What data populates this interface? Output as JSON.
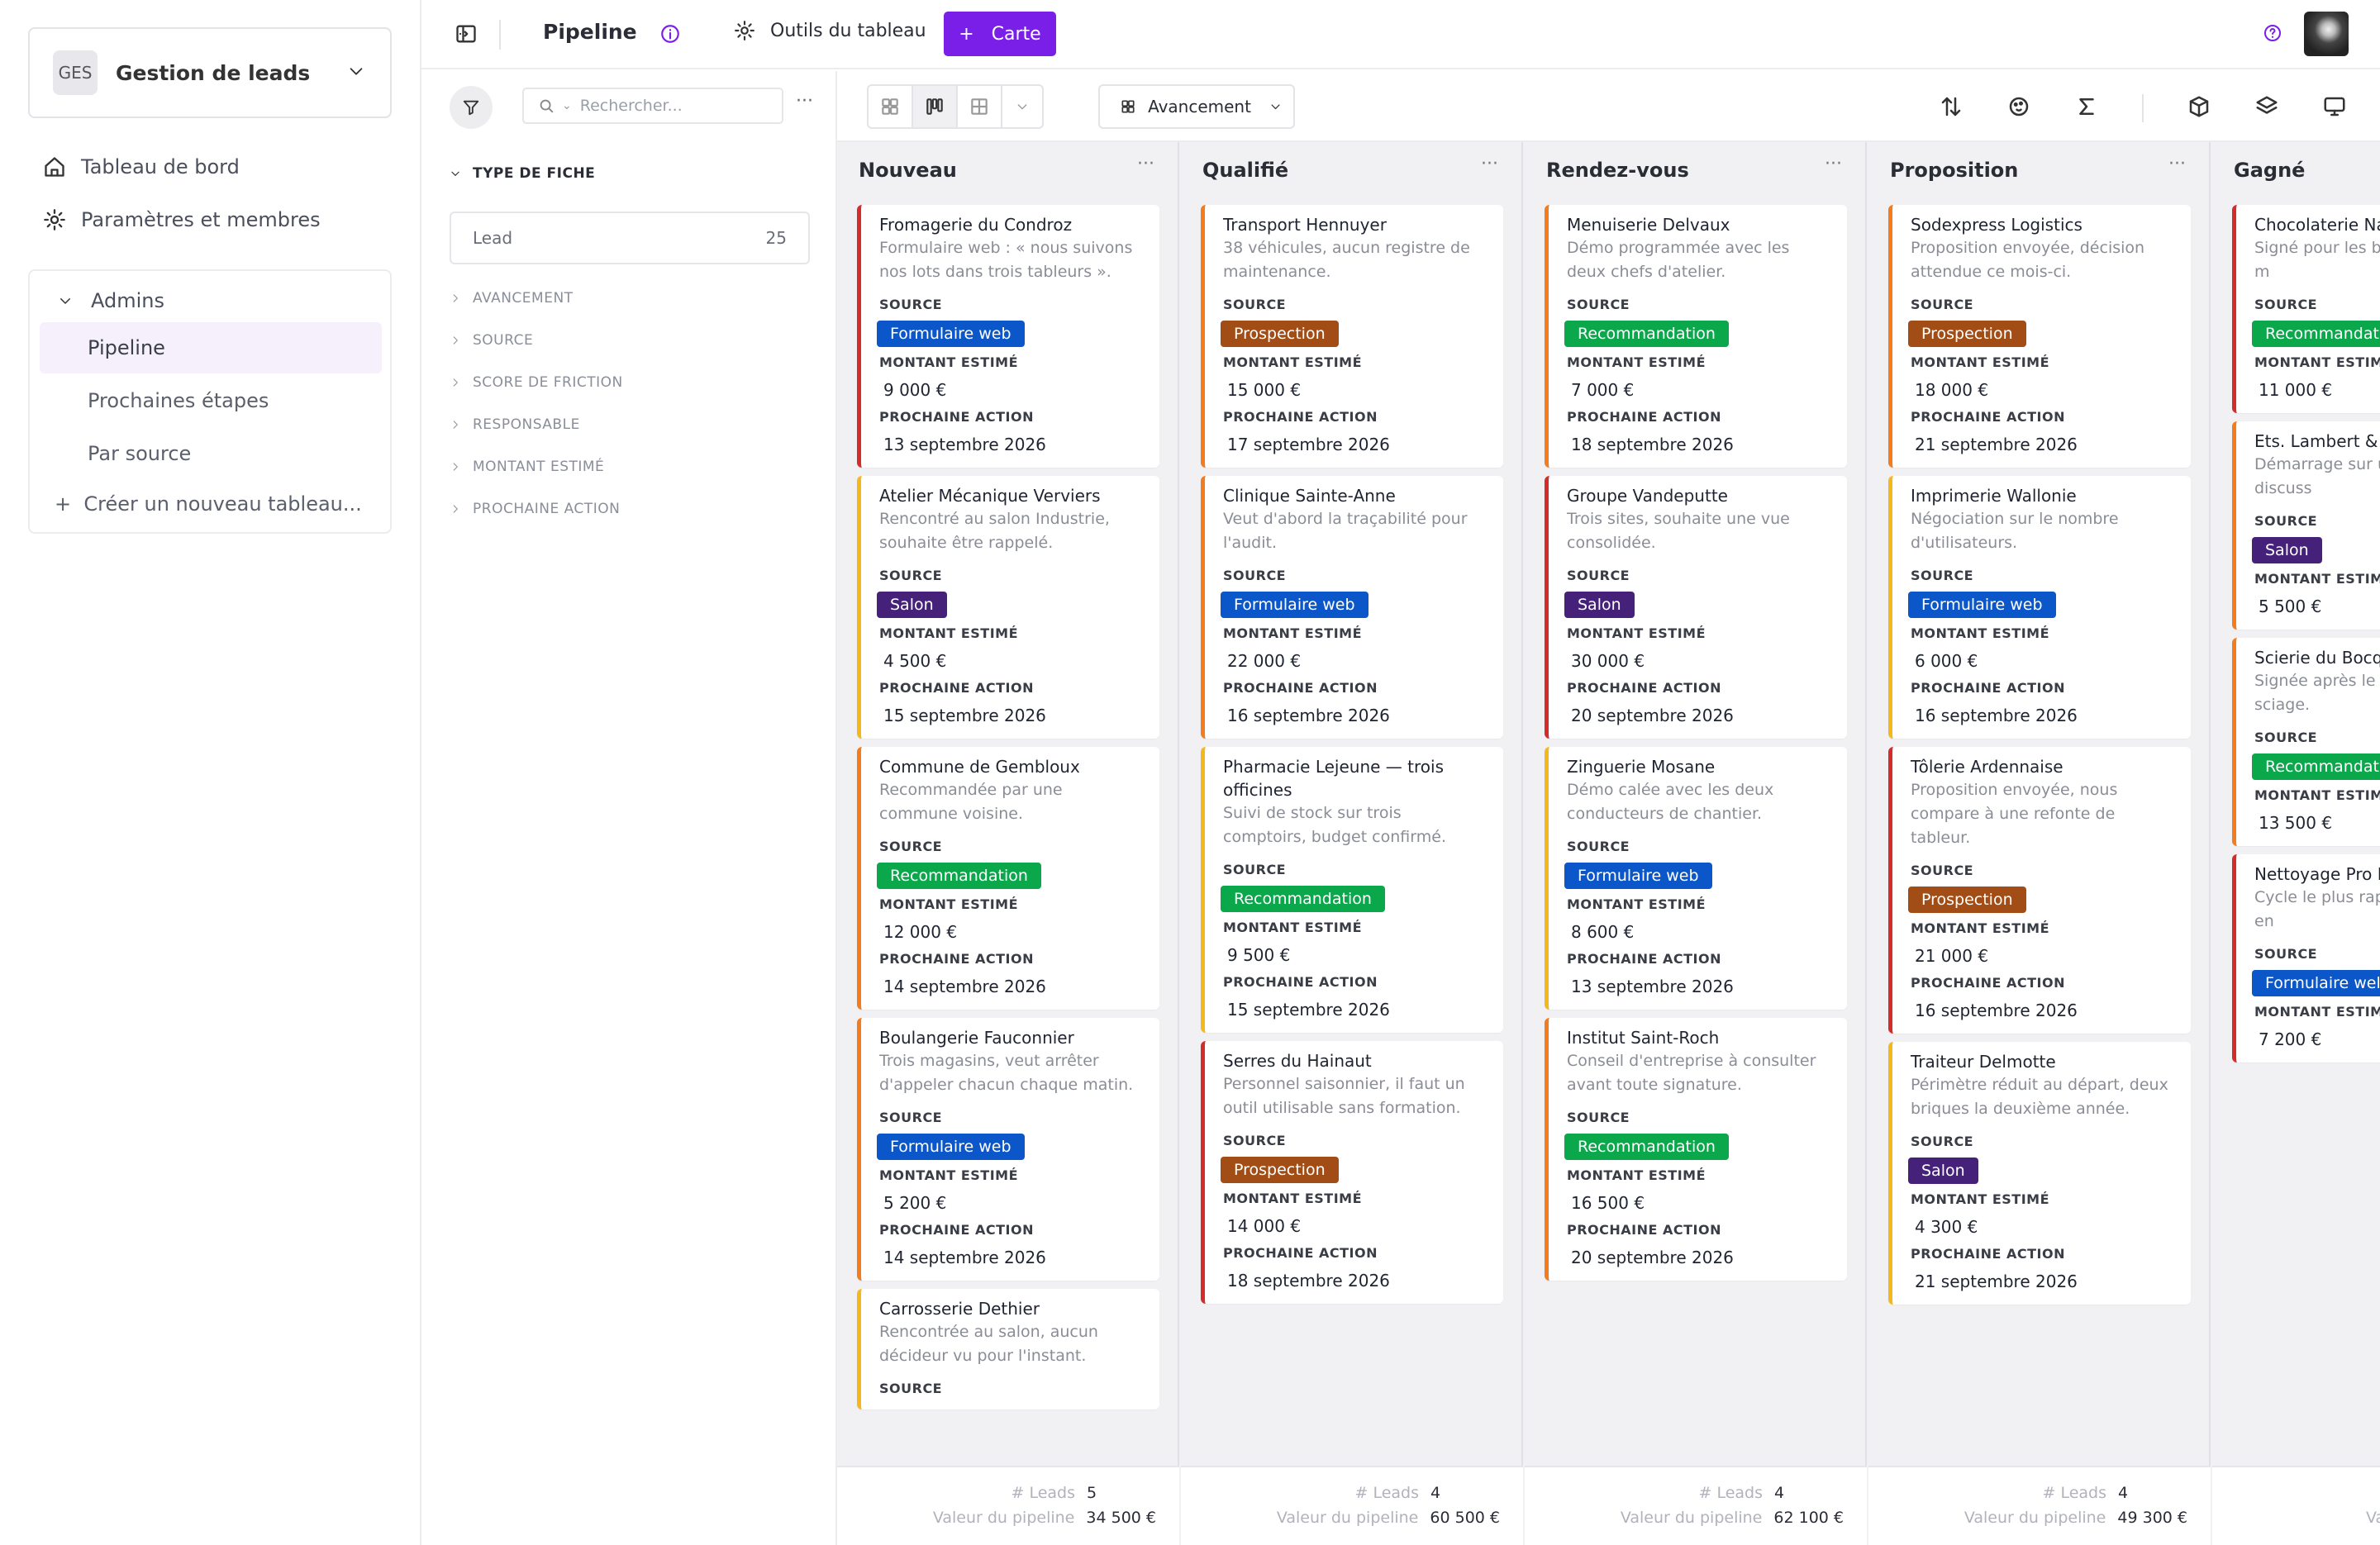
{
  "workspace": {
    "badge": "GES",
    "name": "Gestion de leads"
  },
  "nav": {
    "dashboard": "Tableau de bord",
    "settings": "Paramètres et membres"
  },
  "boards": {
    "group": "Admins",
    "items": [
      "Pipeline",
      "Prochaines étapes",
      "Par source"
    ],
    "create": "Créer un nouveau tableau..."
  },
  "topbar": {
    "title": "Pipeline",
    "tools": "Outils du tableau",
    "add_label": "Carte"
  },
  "filters": {
    "search_placeholder": "Rechercher...",
    "open_section": "TYPE DE FICHE",
    "lead_label": "Lead",
    "lead_count": "25",
    "sections": [
      "AVANCEMENT",
      "SOURCE",
      "SCORE DE FRICTION",
      "RESPONSABLE",
      "MONTANT ESTIMÉ",
      "PROCHAINE ACTION"
    ]
  },
  "toolbar": {
    "group_by": "Avancement"
  },
  "labels": {
    "source": "SOURCE",
    "amount": "MONTANT ESTIMÉ",
    "next_action": "PROCHAINE ACTION",
    "foot_leads": "# Leads",
    "foot_value": "Valeur du pipeline"
  },
  "colors": {
    "accent": "#7a1fe8",
    "formulaire": "#0b57c9",
    "prospection": "#a24d16",
    "recommandation": "#0aa84b",
    "salon": "#45217a"
  },
  "columns": [
    {
      "title": "Nouveau",
      "leads": "5",
      "value": "34 500 €",
      "cards": [
        {
          "name": "Fromagerie du Condroz",
          "desc": "Formulaire web : « nous suivons nos lots dans trois tableurs ».",
          "source": "Formulaire web",
          "amount": "9 000 €",
          "next": "13 septembre 2026",
          "color": "red"
        },
        {
          "name": "Atelier Mécanique Verviers",
          "desc": "Rencontré au salon Industrie, souhaite être rappelé.",
          "source": "Salon",
          "amount": "4 500 €",
          "next": "15 septembre 2026",
          "color": "yellow"
        },
        {
          "name": "Commune de Gembloux",
          "desc": "Recommandée par une commune voisine.",
          "source": "Recommandation",
          "amount": "12 000 €",
          "next": "14 septembre 2026",
          "color": "orange"
        },
        {
          "name": "Boulangerie Fauconnier",
          "desc": "Trois magasins, veut arrêter d'appeler chacun chaque matin.",
          "source": "Formulaire web",
          "amount": "5 200 €",
          "next": "14 septembre 2026",
          "color": "orange"
        },
        {
          "name": "Carrosserie Dethier",
          "desc": "Rencontrée au salon, aucun décideur vu pour l'instant.",
          "source": "",
          "amount": "",
          "next": "",
          "color": "yellow"
        }
      ]
    },
    {
      "title": "Qualifié",
      "leads": "4",
      "value": "60 500 €",
      "cards": [
        {
          "name": "Transport Hennuyer",
          "desc": "38 véhicules, aucun registre de maintenance.",
          "source": "Prospection",
          "amount": "15 000 €",
          "next": "17 septembre 2026",
          "color": "orange"
        },
        {
          "name": "Clinique Sainte-Anne",
          "desc": "Veut d'abord la traçabilité pour l'audit.",
          "source": "Formulaire web",
          "amount": "22 000 €",
          "next": "16 septembre 2026",
          "color": "orange"
        },
        {
          "name": "Pharmacie Lejeune — trois officines",
          "desc": "Suivi de stock sur trois comptoirs, budget confirmé.",
          "source": "Recommandation",
          "amount": "9 500 €",
          "next": "15 septembre 2026",
          "color": "yellow"
        },
        {
          "name": "Serres du Hainaut",
          "desc": "Personnel saisonnier, il faut un outil utilisable sans formation.",
          "source": "Prospection",
          "amount": "14 000 €",
          "next": "18 septembre 2026",
          "color": "red"
        }
      ]
    },
    {
      "title": "Rendez-vous",
      "leads": "4",
      "value": "62 100 €",
      "cards": [
        {
          "name": "Menuiserie Delvaux",
          "desc": "Démo programmée avec les deux chefs d'atelier.",
          "source": "Recommandation",
          "amount": "7 000 €",
          "next": "18 septembre 2026",
          "color": "orange"
        },
        {
          "name": "Groupe Vandeputte",
          "desc": "Trois sites, souhaite une vue consolidée.",
          "source": "Salon",
          "amount": "30 000 €",
          "next": "20 septembre 2026",
          "color": "red"
        },
        {
          "name": "Zinguerie Mosane",
          "desc": "Démo calée avec les deux conducteurs de chantier.",
          "source": "Formulaire web",
          "amount": "8 600 €",
          "next": "13 septembre 2026",
          "color": "yellow"
        },
        {
          "name": "Institut Saint-Roch",
          "desc": "Conseil d'entreprise à consulter avant toute signature.",
          "source": "Recommandation",
          "amount": "16 500 €",
          "next": "20 septembre 2026",
          "color": "orange"
        }
      ]
    },
    {
      "title": "Proposition",
      "leads": "4",
      "value": "49 300 €",
      "cards": [
        {
          "name": "Sodexpress Logistics",
          "desc": "Proposition envoyée, décision attendue ce mois-ci.",
          "source": "Prospection",
          "amount": "18 000 €",
          "next": "21 septembre 2026",
          "color": "orange"
        },
        {
          "name": "Imprimerie Wallonie",
          "desc": "Négociation sur le nombre d'utilisateurs.",
          "source": "Formulaire web",
          "amount": "6 000 €",
          "next": "16 septembre 2026",
          "color": "yellow"
        },
        {
          "name": "Tôlerie Ardennaise",
          "desc": "Proposition envoyée, nous compare à une refonte de tableur.",
          "source": "Prospection",
          "amount": "21 000 €",
          "next": "16 septembre 2026",
          "color": "red"
        },
        {
          "name": "Traiteur Delmotte",
          "desc": "Périmètre réduit au départ, deux briques la deuxième année.",
          "source": "Salon",
          "amount": "4 300 €",
          "next": "21 septembre 2026",
          "color": "yellow"
        }
      ]
    },
    {
      "title": "Gagné",
      "leads": "",
      "value": "",
      "cards": [
        {
          "name": "Chocolaterie Nam",
          "desc": "Signé pour les bi conformités et m",
          "source": "Recommandat",
          "sourceType": "Recommandation",
          "amount": "11 000 €",
          "next": "",
          "color": "red"
        },
        {
          "name": "Ets. Lambert & F",
          "desc": "Démarrage sur u autres en discuss",
          "source": "Salon",
          "amount": "5 500 €",
          "next": "",
          "color": "orange"
        },
        {
          "name": "Scierie du Bocq",
          "desc": "Signée après le p ligne de sciage.",
          "source": "Recommandat",
          "sourceType": "Recommandation",
          "amount": "13 500 €",
          "next": "",
          "color": "orange"
        },
        {
          "name": "Nettoyage Pro L",
          "desc": "Cycle le plus rap trois semaines en",
          "source": "Formulaire wel",
          "sourceType": "Formulaire web",
          "amount": "7 200 €",
          "next": "",
          "color": "red"
        }
      ]
    }
  ],
  "gagne_foot_value_label": "Valeur d"
}
